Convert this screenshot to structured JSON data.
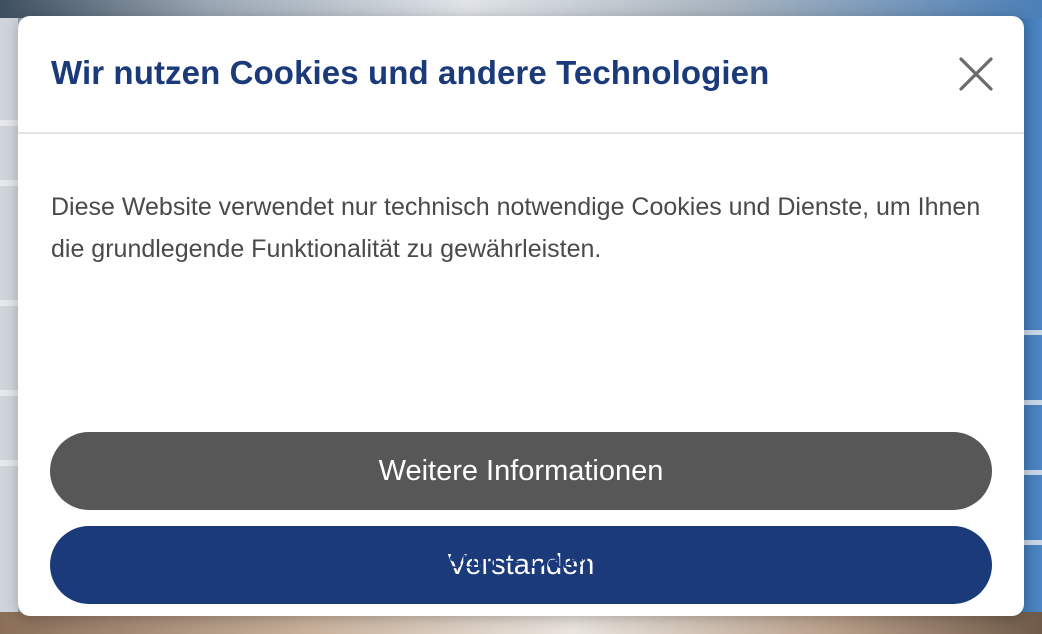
{
  "cookie_dialog": {
    "title": "Wir nutzen Cookies und andere Technologien",
    "close_icon": "close-icon",
    "description": "Diese Website verwendet nur technisch notwendige Cookies und Dienste, um Ihnen die grundlegende Funktionalität zu gewährleisten.",
    "more_info_label": "Weitere Informationen",
    "accept_label": "Verstanden",
    "footer": {
      "imprint_label": "Impressum",
      "separator": "–",
      "privacy_label": "Datenschutz"
    }
  },
  "colors": {
    "brand_blue": "#1b3a7a",
    "secondary_gray": "#575757",
    "text_gray": "#4a4a4a",
    "modal_bg": "#ffffff"
  }
}
